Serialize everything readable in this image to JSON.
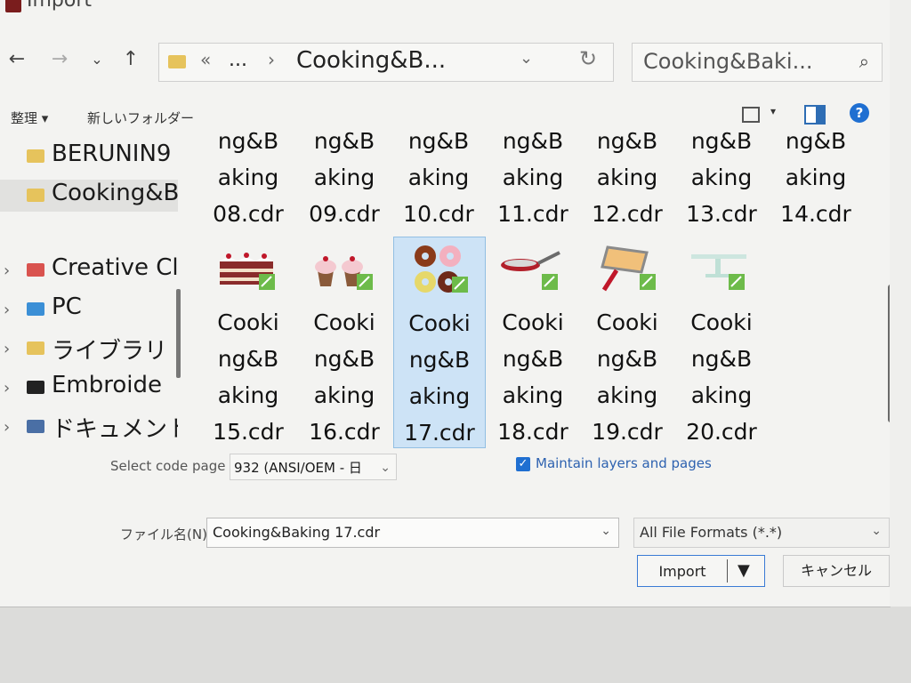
{
  "window": {
    "title": "Import"
  },
  "address": {
    "overflow": "«",
    "ellipsis": "...",
    "separator": "›",
    "path": "Cooking&B...",
    "search_placeholder": "Cooking&Baki..."
  },
  "toolbar": {
    "organize": "整理 ▾",
    "new_folder": "新しいフォルダー",
    "help": "?"
  },
  "nav": {
    "items": [
      {
        "label": "BERUNIN9",
        "icon": "folder-icon",
        "color": "#e6c35c",
        "chevron": ""
      },
      {
        "label": "Cooking&B",
        "icon": "folder-icon",
        "color": "#e6c35c",
        "chevron": "",
        "selected": true
      },
      {
        "label": "Creative Cl",
        "icon": "creative-cloud-icon",
        "color": "#d9534f",
        "chevron": "›"
      },
      {
        "label": "PC",
        "icon": "pc-icon",
        "color": "#3b8fd6",
        "chevron": "›"
      },
      {
        "label": "ライブラリ",
        "icon": "library-icon",
        "color": "#e6c35c",
        "chevron": "›"
      },
      {
        "label": "Embroide",
        "icon": "embroidery-icon",
        "color": "#222222",
        "chevron": "›"
      },
      {
        "label": "ドキュメント",
        "icon": "documents-icon",
        "color": "#4a6fa5",
        "chevron": "›"
      }
    ]
  },
  "files": {
    "row1": [
      {
        "lines": [
          "ng&B",
          "aking",
          "08.cdr"
        ]
      },
      {
        "lines": [
          "ng&B",
          "aking",
          "09.cdr"
        ]
      },
      {
        "lines": [
          "ng&B",
          "aking",
          "10.cdr"
        ]
      },
      {
        "lines": [
          "ng&B",
          "aking",
          "11.cdr"
        ]
      },
      {
        "lines": [
          "ng&B",
          "aking",
          "12.cdr"
        ]
      },
      {
        "lines": [
          "ng&B",
          "aking",
          "13.cdr"
        ]
      },
      {
        "lines": [
          "ng&B",
          "aking",
          "14.cdr"
        ]
      }
    ],
    "row2": [
      {
        "lines": [
          "Cooki",
          "ng&B",
          "aking",
          "15.cdr"
        ],
        "thumb": "cake-icon"
      },
      {
        "lines": [
          "Cooki",
          "ng&B",
          "aking",
          "16.cdr"
        ],
        "thumb": "cupcakes-icon"
      },
      {
        "lines": [
          "Cooki",
          "ng&B",
          "aking",
          "17.cdr"
        ],
        "thumb": "donuts-icon",
        "selected": true
      },
      {
        "lines": [
          "Cooki",
          "ng&B",
          "aking",
          "18.cdr"
        ],
        "thumb": "frying-pan-icon"
      },
      {
        "lines": [
          "Cooki",
          "ng&B",
          "aking",
          "19.cdr"
        ],
        "thumb": "baking-tray-icon"
      },
      {
        "lines": [
          "Cooki",
          "ng&B",
          "aking",
          "20.cdr"
        ],
        "thumb": "cake-stand-icon"
      }
    ]
  },
  "options": {
    "code_page_label": "Select code page",
    "code_page_value": "932  (ANSI/OEM - 日",
    "maintain_layers_label": "Maintain layers and pages",
    "maintain_layers_checked": true
  },
  "footer": {
    "filename_label": "ファイル名(N):",
    "filename_value": "Cooking&Baking 17.cdr",
    "format_value": "All File Formats (*.*)",
    "import_label": "Import",
    "cancel_label": "キャンセル"
  },
  "colors": {
    "accent": "#1f6fd1",
    "selection": "#cde3f6",
    "folder": "#e6c35c"
  }
}
